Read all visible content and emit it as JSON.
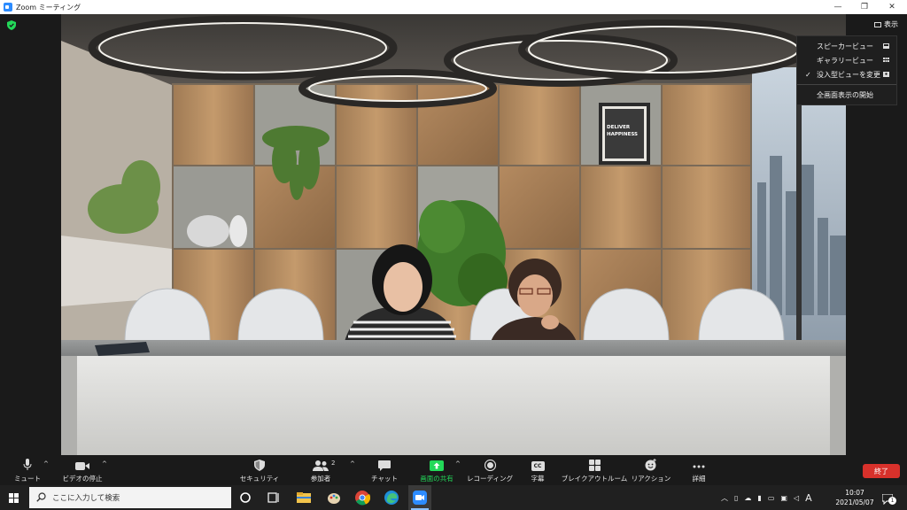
{
  "window": {
    "title": "Zoom ミーティング"
  },
  "view_button": {
    "label": "表示"
  },
  "view_menu": {
    "items": [
      {
        "label": "スピーカービュー",
        "checked": false,
        "icon": "speaker-view-icon"
      },
      {
        "label": "ギャラリービュー",
        "checked": false,
        "icon": "gallery-view-icon"
      },
      {
        "label": "没入型ビューを変更",
        "checked": true,
        "check_mark": "✓",
        "icon": "immersive-view-icon"
      }
    ],
    "fullscreen_label": "全画面表示の開始"
  },
  "scene": {
    "poster_text_1": "DELIVER",
    "poster_text_2": "HAPPINESS"
  },
  "toolbar": {
    "mute_label": "ミュート",
    "video_label": "ビデオの停止",
    "security_label": "セキュリティ",
    "participants_label": "参加者",
    "participants_count": "2",
    "chat_label": "チャット",
    "share_label": "画面の共有",
    "record_label": "レコーディング",
    "captions_label": "字幕",
    "captions_icon_text": "CC",
    "breakout_label": "ブレイクアウトルーム",
    "reactions_label": "リアクション",
    "more_label": "詳細",
    "end_label": "終了",
    "caret": "^"
  },
  "taskbar": {
    "search_placeholder": "ここに入力して検索",
    "ime_label": "A",
    "time": "10:07",
    "date": "2021/05/07",
    "notification_count": "1"
  },
  "colors": {
    "accent": "#2d8cff",
    "share_green": "#23d959",
    "end_red": "#d8312b"
  }
}
